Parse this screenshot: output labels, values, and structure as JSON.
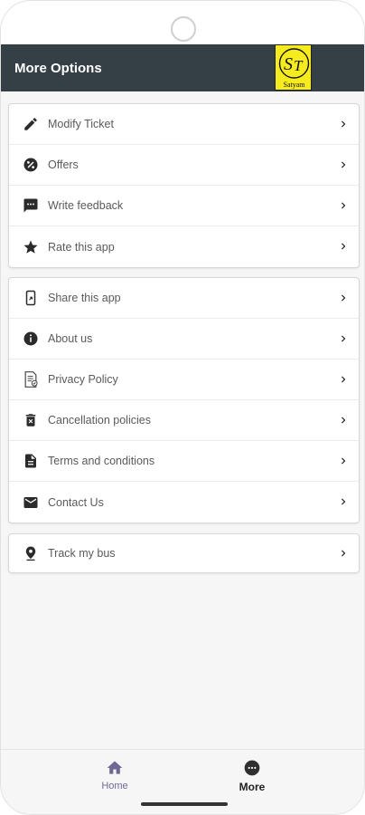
{
  "appbar": {
    "title": "More Options",
    "logo_text": "Satyam"
  },
  "groups": [
    {
      "items": [
        {
          "label": "Modify Ticket",
          "icon": "pencil-icon"
        },
        {
          "label": "Offers",
          "icon": "offers-icon"
        },
        {
          "label": "Write feedback",
          "icon": "feedback-icon"
        },
        {
          "label": "Rate this app",
          "icon": "star-icon"
        }
      ]
    },
    {
      "items": [
        {
          "label": "Share this app",
          "icon": "share-icon"
        },
        {
          "label": "About us",
          "icon": "info-icon"
        },
        {
          "label": "Privacy Policy",
          "icon": "policy-document-icon"
        },
        {
          "label": "Cancellation policies",
          "icon": "trash-icon"
        },
        {
          "label": "Terms and conditions",
          "icon": "document-icon"
        },
        {
          "label": "Contact Us",
          "icon": "mail-icon"
        }
      ]
    },
    {
      "items": [
        {
          "label": "Track my bus",
          "icon": "location-pin-icon"
        }
      ]
    }
  ],
  "bottom_nav": {
    "home_label": "Home",
    "more_label": "More"
  },
  "colors": {
    "appbar": "#353f46",
    "logo_bg": "#f5eb1e",
    "nav_home": "#6e6893"
  }
}
